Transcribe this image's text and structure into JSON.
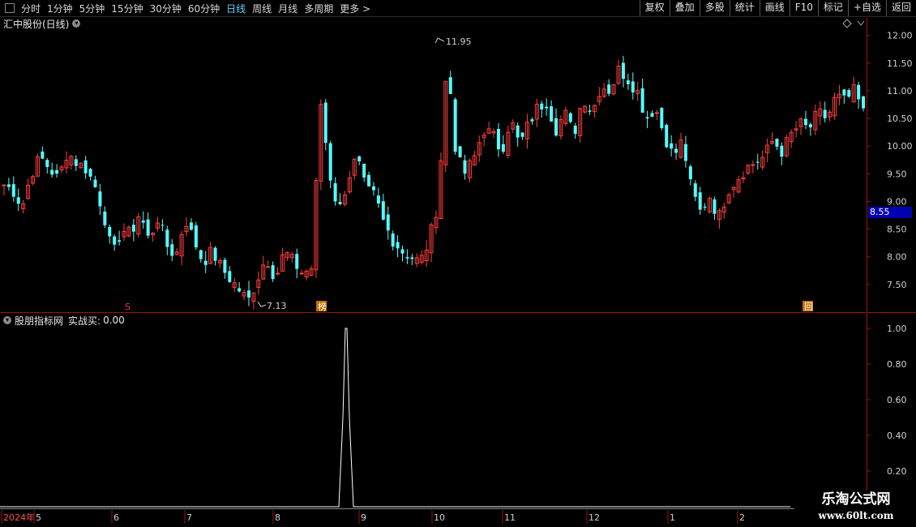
{
  "toolbar": {
    "periods": [
      "分时",
      "1分钟",
      "5分钟",
      "15分钟",
      "30分钟",
      "60分钟",
      "日线",
      "周线",
      "月线",
      "多周期",
      "更多 >"
    ],
    "active_period": "日线",
    "buttons": [
      "复权",
      "叠加",
      "多股",
      "统计",
      "画线",
      "F10",
      "标记",
      "+自选",
      "返回"
    ]
  },
  "main_panel": {
    "title": "汇中股份(日线)",
    "high_label": "11.95",
    "low_label": "7.13",
    "current_price": "8.55",
    "markers": [
      "S",
      "榜",
      "回"
    ],
    "y_ticks": [
      "12.00",
      "11.50",
      "11.00",
      "10.50",
      "10.00",
      "9.50",
      "9.00",
      "8.50",
      "8.00",
      "7.50"
    ]
  },
  "indicator_panel": {
    "title": "股朋指标网",
    "field_label": "实战买:",
    "field_value": "0.00",
    "y_ticks": [
      "1.00",
      "0.80",
      "0.60",
      "0.40",
      "0.20"
    ]
  },
  "date_axis": {
    "labels": [
      "2024年",
      "5",
      "6",
      "7",
      "8",
      "9",
      "10",
      "11",
      "12",
      "1",
      "2"
    ]
  },
  "watermark": {
    "title": "乐淘公式网",
    "url": "www.60lt.com"
  },
  "colors": {
    "up": "#ff3c3c",
    "down": "#54ffff",
    "grid": "#a01010",
    "active": "#5fd7ff"
  },
  "chart_data": {
    "type": "candlestick",
    "y_range": [
      7.0,
      12.2
    ],
    "close_path": [
      9.3,
      9.2,
      8.9,
      9.5,
      9.8,
      9.6,
      9.4,
      9.9,
      9.7,
      9.6,
      9.3,
      8.8,
      8.0,
      8.5,
      8.4,
      8.8,
      8.3,
      8.7,
      8.2,
      8.0,
      8.7,
      8.3,
      7.9,
      8.1,
      7.8,
      7.6,
      7.4,
      7.2,
      7.6,
      8.0,
      7.6,
      8.1,
      7.9,
      7.7,
      7.8,
      10.8,
      9.5,
      8.8,
      9.4,
      9.8,
      9.2,
      9.1,
      8.6,
      8.3,
      8.1,
      8.0,
      7.9,
      8.3,
      9.0,
      11.6,
      9.8,
      9.5,
      9.8,
      10.3,
      10.2,
      9.9,
      10.5,
      10.0,
      10.4,
      10.7,
      10.8,
      10.3,
      10.6,
      10.2,
      10.9,
      10.6,
      11.1,
      11.0,
      11.4,
      11.2,
      11.0,
      10.5,
      10.7,
      10.2,
      9.8,
      10.1,
      9.2,
      8.8,
      9.1,
      8.7,
      9.2,
      9.4,
      9.6,
      9.7,
      9.8,
      10.1,
      9.9,
      10.2,
      10.4,
      10.3,
      10.6,
      10.5,
      10.9,
      10.8,
      11.0,
      10.6
    ]
  }
}
